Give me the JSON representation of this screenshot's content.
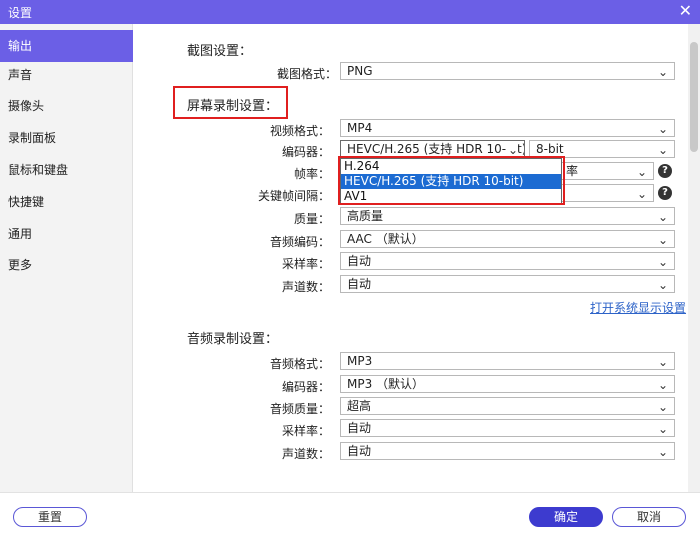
{
  "window": {
    "title": "设置",
    "close_glyph": "✕"
  },
  "sidebar": {
    "items": [
      {
        "label": "输出",
        "active": true
      },
      {
        "label": "声音"
      },
      {
        "label": "摄像头"
      },
      {
        "label": "录制面板"
      },
      {
        "label": "鼠标和键盘"
      },
      {
        "label": "快捷键"
      },
      {
        "label": "通用"
      },
      {
        "label": "更多"
      }
    ]
  },
  "screenshot_settings": {
    "title": "截图设置：",
    "format_label": "截图格式：",
    "format_value": "PNG"
  },
  "screen_recording": {
    "title": "屏幕录制设置：",
    "video_format_label": "视频格式：",
    "video_format_value": "MP4",
    "encoder_label": "编码器：",
    "encoder_value": "HEVC/H.265 (支持 HDR 10-bit)",
    "bit_depth_value": "8-bit",
    "framerate_label": "帧率：",
    "framerate_partial": "率",
    "keyframe_label": "关键帧间隔：",
    "quality_label": "质量：",
    "quality_value": "高质量",
    "audio_codec_label": "音频编码：",
    "audio_codec_value": "AAC （默认）",
    "sample_rate_label": "采样率：",
    "sample_rate_value": "自动",
    "channels_label": "声道数：",
    "channels_value": "自动",
    "display_settings_link": "打开系统显示设置",
    "encoder_options": [
      "H.264",
      "HEVC/H.265 (支持 HDR 10-bit)",
      "AV1"
    ],
    "encoder_selected_index": 1
  },
  "audio_recording": {
    "title": "音频录制设置：",
    "format_label": "音频格式：",
    "format_value": "MP3",
    "encoder_label": "编码器：",
    "encoder_value": "MP3 （默认）",
    "quality_label": "音频质量：",
    "quality_value": "超高",
    "sample_rate_label": "采样率：",
    "sample_rate_value": "自动",
    "channels_label": "声道数：",
    "channels_value": "自动"
  },
  "footer": {
    "reset_label": "重置",
    "ok_label": "确定",
    "cancel_label": "取消"
  },
  "icons": {
    "chevron": "⌄",
    "help": "?"
  },
  "colors": {
    "accent": "#6b5fe6",
    "highlight": "#e01f1f",
    "selection": "#1c6bd2",
    "link": "#2d63c8"
  }
}
